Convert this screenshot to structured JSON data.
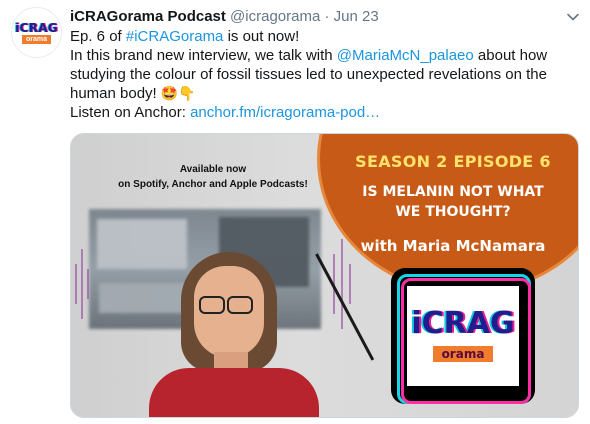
{
  "author": {
    "display_name": "iCRAGorama Podcast",
    "handle": "@icragorama",
    "separator": "·",
    "date": "Jun 23",
    "avatar_text_top": "iCRAG",
    "avatar_text_bottom": "orama"
  },
  "tweet": {
    "line1_pre": "Ep. 6 of ",
    "line1_hashtag": "#iCRAGorama",
    "line1_post": " is out now!",
    "line2_pre": "In this brand new interview, we talk with ",
    "line2_mention": "@MariaMcN_palaeo",
    "line2_post": " about how",
    "line3": "studying the colour of fossil tissues led to unexpected revelations on the",
    "line4": "human body! ",
    "line4_emoji1": "🤩",
    "line4_emoji2": "👇",
    "line5_pre": "Listen on Anchor: ",
    "line5_link": "anchor.fm/icragorama-pod…"
  },
  "media": {
    "available_line1": "Available now",
    "available_line2": "on Spotify, Anchor and Apple Podcasts!",
    "season": "SEASON 2 EPISODE 6",
    "title_line1": "IS MELANIN NOT WHAT",
    "title_line2": "WE THOUGHT?",
    "guest": "with Maria McNamara",
    "logo_top": "iCRAG",
    "logo_bottom": "orama"
  },
  "colors": {
    "link": "#1b95e0",
    "secondary_text": "#657786",
    "orange": "#c85a17",
    "season_yellow": "#ffe26a"
  },
  "icons": {
    "caret": "chevron-down-icon"
  }
}
